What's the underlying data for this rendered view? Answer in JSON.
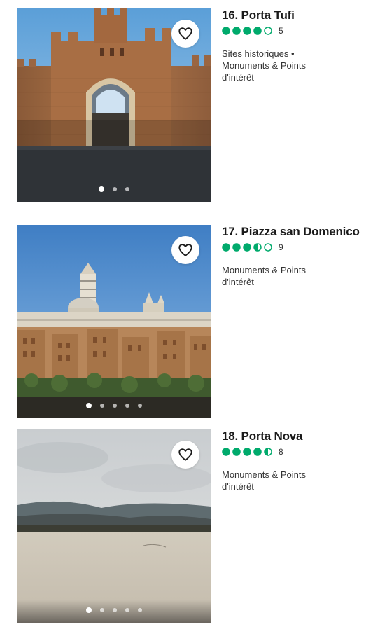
{
  "accent": "#00aa6c",
  "items": [
    {
      "title": "16. Porta Tufi",
      "rating": 4,
      "review_count": "5",
      "category_lines": [
        "Sites historiques •",
        "Monuments & Points",
        "d'intérêt"
      ],
      "dots_total": 3,
      "dots_active": 1,
      "favorite_icon": "heart-icon"
    },
    {
      "title": "17. Piazza san Domenico",
      "rating": 3.5,
      "review_count": "9",
      "category_lines": [
        "Monuments & Points",
        "d'intérêt"
      ],
      "dots_total": 5,
      "dots_active": 1,
      "favorite_icon": "heart-icon"
    },
    {
      "title": "18. Porta Nova",
      "rating": 4.5,
      "review_count": "8",
      "category_lines": [
        "Monuments & Points",
        "d'intérêt"
      ],
      "dots_total": 5,
      "dots_active": 1,
      "favorite_icon": "heart-icon"
    }
  ]
}
